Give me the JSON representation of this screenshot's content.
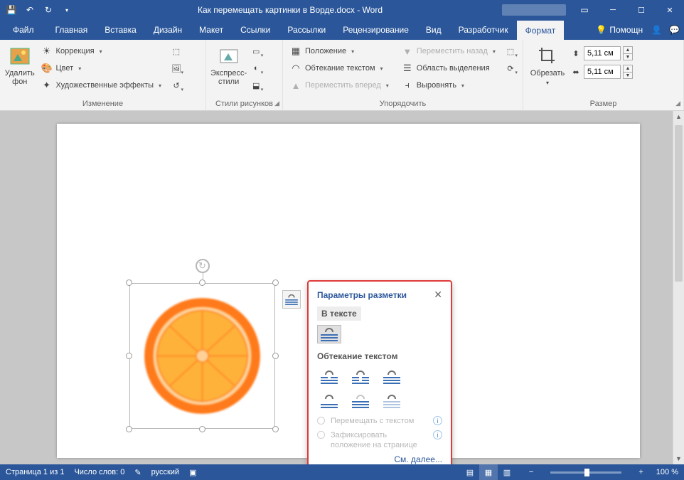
{
  "titlebar": {
    "doc_title": "Как перемещать картинки в Ворде.docx - Word"
  },
  "tabs": {
    "file": "Файл",
    "items": [
      "Главная",
      "Вставка",
      "Дизайн",
      "Макет",
      "Ссылки",
      "Рассылки",
      "Рецензирование",
      "Вид",
      "Разработчик"
    ],
    "active": "Формат",
    "help": "Помощн"
  },
  "ribbon": {
    "remove_bg": "Удалить\nфон",
    "corrections": "Коррекция",
    "color": "Цвет",
    "artistic": "Художественные эффекты",
    "group_adjust": "Изменение",
    "quick_styles": "Экспресс-\nстили",
    "group_styles": "Стили рисунков",
    "position": "Положение",
    "wrap": "Обтекание текстом",
    "forward": "Переместить вперед",
    "backward": "Переместить назад",
    "selection_pane": "Область выделения",
    "align": "Выровнять",
    "group_arrange": "Упорядочить",
    "crop": "Обрезать",
    "height_val": "5,11 см",
    "width_val": "5,11 см",
    "group_size": "Размер"
  },
  "layout_popup": {
    "title": "Параметры разметки",
    "inline_label": "В тексте",
    "wrap_label": "Обтекание текстом",
    "radio_move": "Перемещать с текстом",
    "radio_fix": "Зафиксировать положение на странице",
    "see_more": "См. далее..."
  },
  "statusbar": {
    "page": "Страница 1 из 1",
    "words": "Число слов: 0",
    "lang": "русский",
    "zoom": "100 %"
  }
}
